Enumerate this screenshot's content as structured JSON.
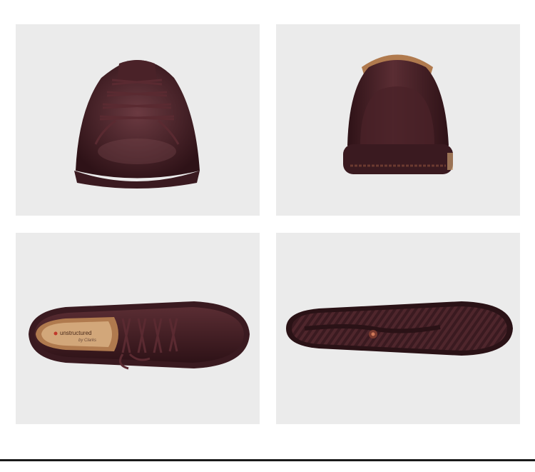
{
  "gallery": {
    "views": [
      {
        "id": "front-view",
        "label": ""
      },
      {
        "id": "back-view",
        "label": ""
      },
      {
        "id": "top-view",
        "label": ""
      },
      {
        "id": "sole-view",
        "label": ""
      }
    ],
    "insole_logo": "unstructured",
    "insole_brand": "by Clarks"
  },
  "colors": {
    "panel_bg": "#ebebeb",
    "leather": "#3f1c22",
    "leather_highlight": "#6b3a41",
    "sole": "#3a1a20",
    "lining": "#b07a4e"
  }
}
